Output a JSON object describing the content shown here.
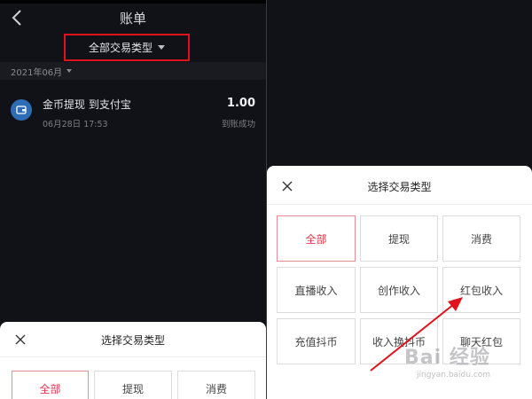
{
  "left_panel": {
    "header": {
      "title": "账单",
      "filter_label": "全部交易类型"
    },
    "month": "2021年06月",
    "transaction": {
      "title": "金币提现 到支付宝",
      "date": "06月28日 17:53",
      "amount": "1.00",
      "status": "到账成功"
    },
    "sheet": {
      "title": "选择交易类型",
      "options": [
        "全部",
        "提现",
        "消费"
      ],
      "selected": "全部"
    }
  },
  "right_panel": {
    "sheet": {
      "title": "选择交易类型",
      "options": [
        "全部",
        "提现",
        "消费",
        "直播收入",
        "创作收入",
        "红包收入",
        "充值抖币",
        "收入换抖币",
        "聊天红包"
      ],
      "selected": "全部"
    }
  },
  "annotation": {
    "highlight_color": "#e0121b",
    "arrow_color": "#e0121b",
    "arrow_target": "红包收入"
  },
  "watermark": {
    "text": "Bai 经验",
    "url": "jingyan.baidu.com"
  },
  "colors": {
    "background": "#111217",
    "active_text": "#ea3a4e",
    "active_border": "#f08a94"
  }
}
